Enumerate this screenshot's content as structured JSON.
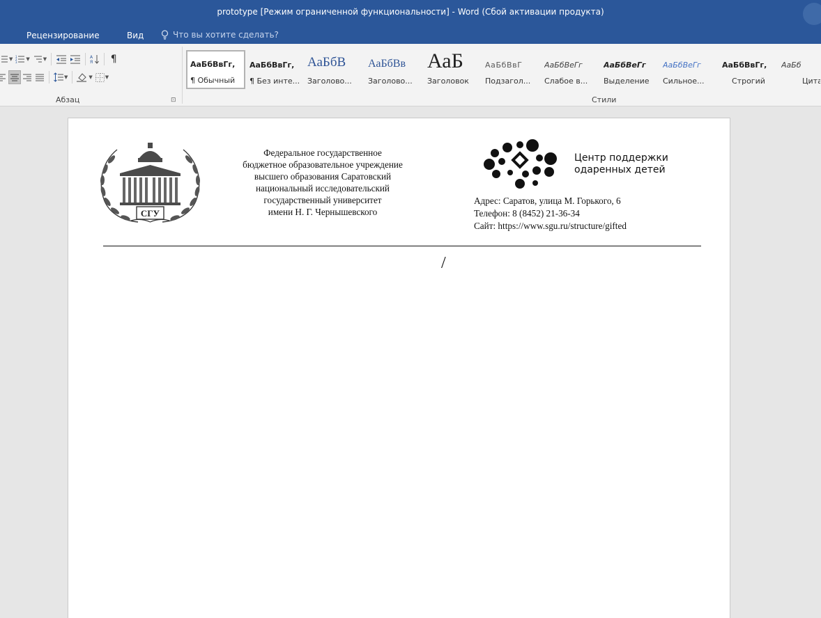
{
  "window": {
    "title": "prototype [Режим ограниченной функциональности] - Word (Сбой активации продукта)"
  },
  "ribbon_tabs": [
    {
      "label": "Рецензирование"
    },
    {
      "label": "Вид"
    }
  ],
  "tell_me": {
    "placeholder": "Что вы хотите сделать?"
  },
  "paragraph_group": {
    "label": "Абзац",
    "launcher": "⊡"
  },
  "styles_group": {
    "label": "Стили",
    "items": [
      {
        "sample": "АаБбВвГг,",
        "name": "¶ Обычный"
      },
      {
        "sample": "АаБбВвГг,",
        "name": "¶ Без инте..."
      },
      {
        "sample": "АаБбВ",
        "name": "Заголово..."
      },
      {
        "sample": "АаБбВв",
        "name": "Заголово..."
      },
      {
        "sample": "АаБ",
        "name": "Заголовок"
      },
      {
        "sample": "АаБбВвГ",
        "name": "Подзагол..."
      },
      {
        "sample": "АаБбВеГг",
        "name": "Слабое в..."
      },
      {
        "sample": "АаБбВеГг",
        "name": "Выделение"
      },
      {
        "sample": "АаБбВеГг",
        "name": "Сильное..."
      },
      {
        "sample": "АаБбВвГг,",
        "name": "Строгий"
      },
      {
        "sample": "АаБб",
        "name": "Цита"
      }
    ]
  },
  "colors": {
    "titlebar": "#2b579a",
    "ribbon": "#f3f3f3",
    "heading_blue": "#2f5496",
    "emphasis_blue": "#4472c4"
  },
  "document": {
    "org_lines": [
      "Федеральное государственное",
      "бюджетное образовательное учреждение",
      "высшего образования Саратовский",
      "национальный исследовательский",
      "государственный университет",
      "имени Н. Г. Чернышевского"
    ],
    "logo_text": "СГУ",
    "center_name": [
      "Центр поддержки",
      "одаренных детей"
    ],
    "contacts": [
      "Адрес: Саратов, улица М. Горького, 6",
      "Телефон: 8 (8452) 21-36-34",
      "Сайт: https://www.sgu.ru/structure/gifted"
    ],
    "cursor_mark": "/"
  }
}
